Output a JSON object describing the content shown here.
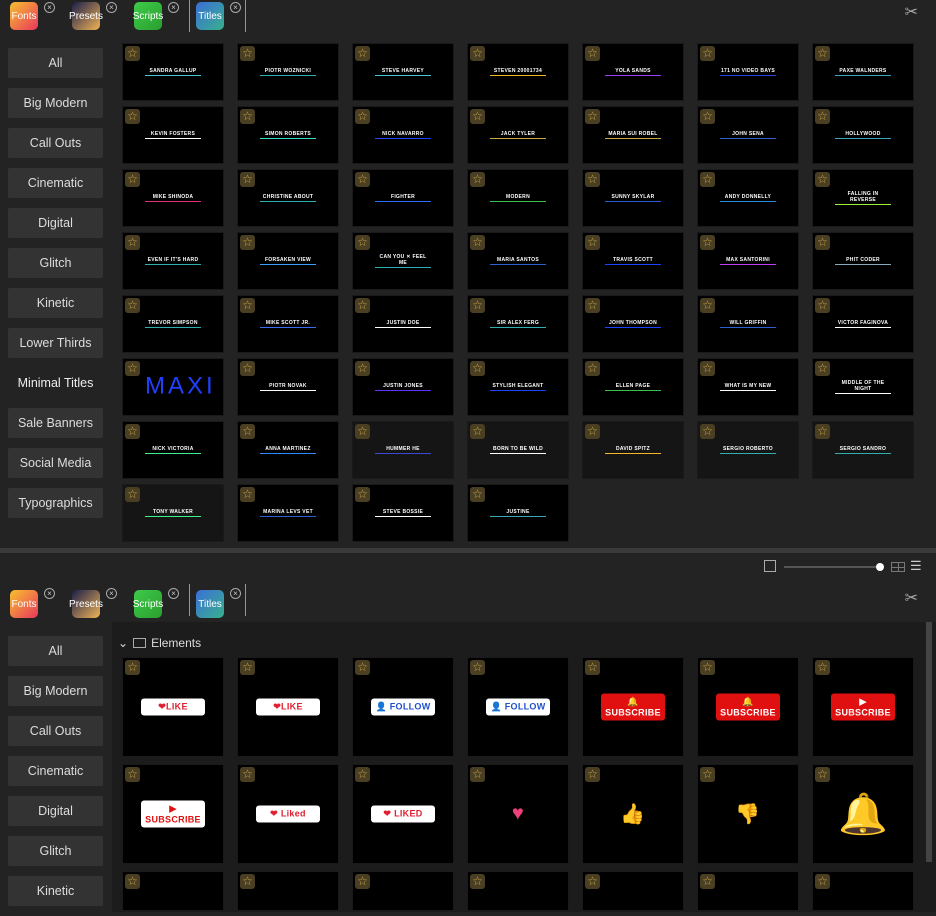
{
  "tabs": [
    {
      "label": "Fonts",
      "bg": "linear-gradient(135deg,#f9c12e,#e8365e)"
    },
    {
      "label": "Presets",
      "bg": "linear-gradient(135deg,#1a1d4a,#f1b457)"
    },
    {
      "label": "Scripts",
      "bg": "linear-gradient(135deg,#3ecb4a,#2a9e2e)"
    },
    {
      "label": "Titles",
      "bg": "linear-gradient(135deg,#3b6fd8,#38b08c)"
    }
  ],
  "close_glyph": "×",
  "categories": [
    "All",
    "Big Modern",
    "Call Outs",
    "Cinematic",
    "Digital",
    "Glitch",
    "Kinetic",
    "Lower Thirds",
    "Minimal Titles",
    "Sale Banners",
    "Social Media",
    "Typographics"
  ],
  "selected_category": "Minimal Titles",
  "top_thumbs": [
    {
      "t": "SANDRA GALLUP",
      "c": "#4bc6d6"
    },
    {
      "t": "PIOTR WOZNICKI",
      "c": "#2fb0b0"
    },
    {
      "t": "STEVE HARVEY",
      "c": "#4bc6d6"
    },
    {
      "t": "STEVEN 20001734",
      "c": "#f4b72a"
    },
    {
      "t": "YOLA SANDS",
      "c": "#9a3cf0"
    },
    {
      "t": "171 NO VIDEO BAYS",
      "c": "#2741e8"
    },
    {
      "t": "PAXE WALNDERS",
      "c": "#3aa6b8"
    },
    {
      "t": "KEVIN FOSTERS",
      "c": "#fff"
    },
    {
      "t": "SIMON ROBERTS",
      "c": "#2fe0c8"
    },
    {
      "t": "NICK NAVARRO",
      "c": "#2040ff"
    },
    {
      "t": "JACK TYLER",
      "c": "#c9a84a"
    },
    {
      "t": "MARIA SUI ROBEL",
      "c": "#c9a84a"
    },
    {
      "t": "JOHN SENA",
      "c": "#3060d0"
    },
    {
      "t": "HOLLYWOOD",
      "c": "#3aa6b8"
    },
    {
      "t": "MIKE SHINODA",
      "c": "#e0307a"
    },
    {
      "t": "CHRISTINE ABOUT",
      "c": "#2fb0b0"
    },
    {
      "t": "FIGHTER",
      "c": "#2a6dff"
    },
    {
      "t": "MODERN",
      "c": "#3cc04a"
    },
    {
      "t": "SUNNY SKYLAR",
      "c": "#2a5ad8"
    },
    {
      "t": "ANDY DONNELLY",
      "c": "#2a8ad8"
    },
    {
      "t": "FALLING IN REVERSE",
      "c": "#9ef03a"
    },
    {
      "t": "EVEN IF IT'S HARD",
      "c": "#2fb0b0"
    },
    {
      "t": "FORSAKEN VIEW",
      "c": "#3aa0ff"
    },
    {
      "t": "CAN YOU ✕ FEEL ME",
      "c": "#2fb0b0"
    },
    {
      "t": "MARIA SANTOS",
      "c": "#3060d0"
    },
    {
      "t": "TRAVIS SCOTT",
      "c": "#2040ff"
    },
    {
      "t": "MAX SANTORINI",
      "c": "#c03cf0"
    },
    {
      "t": "PHIT CODER",
      "c": "#8ab"
    },
    {
      "t": "TREVOR SIMPSON",
      "c": "#2fb0b0"
    },
    {
      "t": "MIKE SCOTT JR.",
      "c": "#3a6cf0"
    },
    {
      "t": "JUSTIN DOE",
      "c": "#fff"
    },
    {
      "t": "SIR ALEX FERG",
      "c": "#2fb0b0"
    },
    {
      "t": "JOHN THOMPSON",
      "c": "#2040ff"
    },
    {
      "t": "WILL GRIFFIN",
      "c": "#3060d0"
    },
    {
      "t": "VICTOR FAGINOVA",
      "c": "#fff"
    },
    {
      "t": "MAXI",
      "c": "#2040ff",
      "big": true
    },
    {
      "t": "PIOTR NOVAK",
      "c": "#fff"
    },
    {
      "t": "JUSTIN JONES",
      "c": "#6030ff"
    },
    {
      "t": "STYLISH ELEGANT",
      "c": "#2040ff"
    },
    {
      "t": "ELLEN PAGE",
      "c": "#3cc04a"
    },
    {
      "t": "WHAT IS MY NEW",
      "c": "#fff"
    },
    {
      "t": "MIDDLE OF THE NIGHT",
      "c": "#fff"
    },
    {
      "t": "NICK VICTORIA",
      "c": "#3cf08a"
    },
    {
      "t": "ANNA MARTINEZ",
      "c": "#2a8aff"
    },
    {
      "t": "HUMMER HE",
      "c": "#3a4ad0",
      "dim": true
    },
    {
      "t": "BORN TO BE WILD",
      "c": "#fff",
      "dim": true
    },
    {
      "t": "DAVID SPITZ",
      "c": "#f4b72a",
      "dim": true
    },
    {
      "t": "SERGIO ROBERTO",
      "c": "#2fb0b0",
      "dim": true
    },
    {
      "t": "SERGIO SANDRO",
      "c": "#2fb0b0",
      "dim": true
    },
    {
      "t": "TONY WALKER",
      "c": "#3cf08a",
      "dim": true
    },
    {
      "t": "MARINA LEVS VET",
      "c": "#3060d0"
    },
    {
      "t": "STEVE BOSSIE",
      "c": "#fff"
    },
    {
      "t": "JUSTINE",
      "c": "#3aa6b8"
    }
  ],
  "bottom": {
    "section": "Elements",
    "categories": [
      "All",
      "Big Modern",
      "Call Outs",
      "Cinematic",
      "Digital",
      "Glitch",
      "Kinetic"
    ],
    "thumbs": [
      {
        "t": "❤LIKE",
        "fg": "#e02030",
        "bg": "#fff"
      },
      {
        "t": "❤LIKE",
        "fg": "#e02030",
        "bg": "#fff"
      },
      {
        "t": "👤 FOLLOW",
        "fg": "#2050d0",
        "bg": "#fff"
      },
      {
        "t": "👤 FOLLOW",
        "fg": "#2050d0",
        "bg": "#fff"
      },
      {
        "t": "🔔 SUBSCRIBE",
        "fg": "#fff",
        "bg": "#e01010"
      },
      {
        "t": "🔔 SUBSCRIBE",
        "fg": "#fff",
        "bg": "#e01010"
      },
      {
        "t": "▶ SUBSCRIBE",
        "fg": "#fff",
        "bg": "#e01010"
      },
      {
        "t": "▶ SUBSCRIBE",
        "fg": "#e01010",
        "bg": "#fff"
      },
      {
        "t": "❤ Liked",
        "fg": "#e02030",
        "bg": "#fff"
      },
      {
        "t": "❤ LIKED",
        "fg": "#e02030",
        "bg": "#fff"
      },
      {
        "t": "♥",
        "fg": "#f0407a",
        "bg": "",
        "icon": true
      },
      {
        "t": "👍",
        "fg": "#3a8ae8",
        "bg": "",
        "icon": true
      },
      {
        "t": "👎",
        "fg": "#3a8ae8",
        "bg": "",
        "icon": true
      },
      {
        "t": "🔔",
        "fg": "#fff",
        "bg": "",
        "icon": true
      }
    ]
  }
}
